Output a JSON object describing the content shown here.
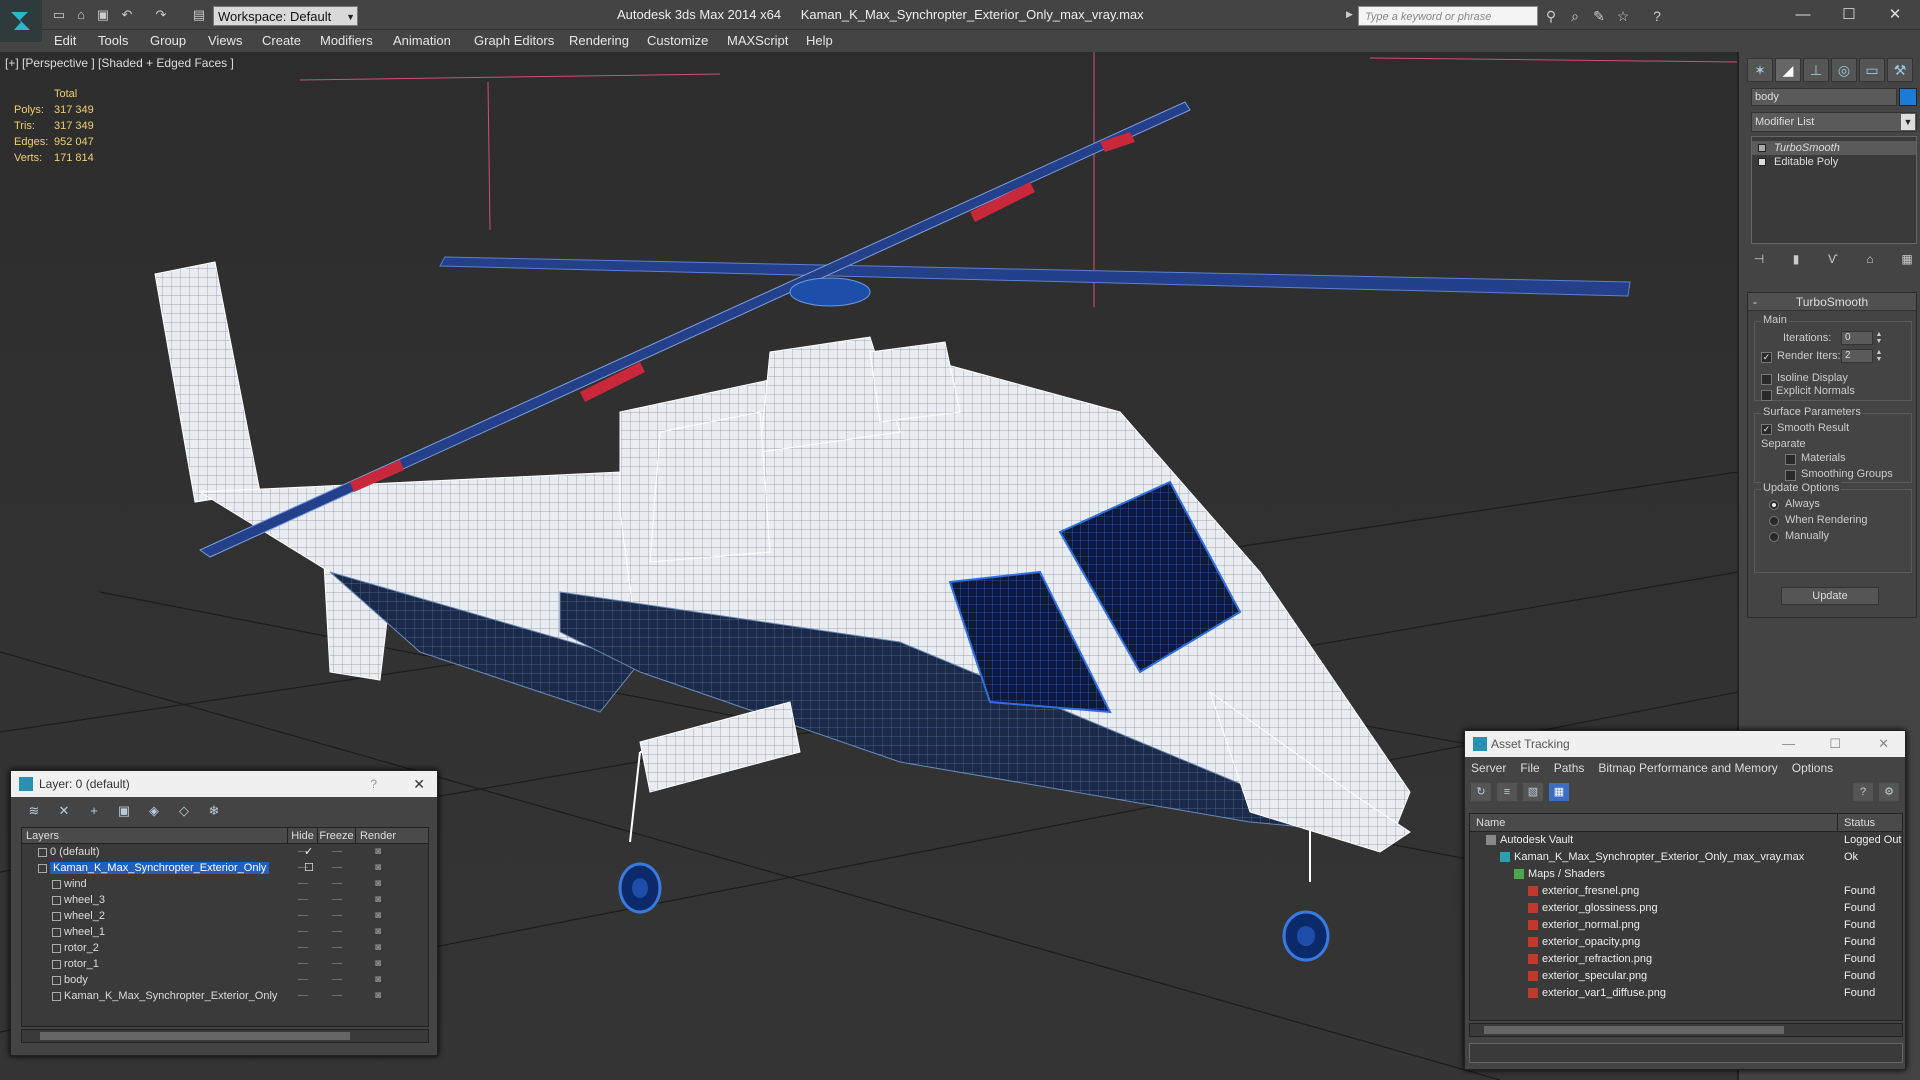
{
  "titlebar": {
    "workspace_label": "Workspace: Default",
    "app_name": "Autodesk 3ds Max  2014 x64",
    "file_name": "Kaman_K_Max_Synchropter_Exterior_Only_max_vray.max",
    "search_placeholder": "Type a keyword or phrase"
  },
  "menu": [
    "Edit",
    "Tools",
    "Group",
    "Views",
    "Create",
    "Modifiers",
    "Animation",
    "Graph Editors",
    "Rendering",
    "Customize",
    "MAXScript",
    "Help"
  ],
  "viewport": {
    "label": "[+] [Perspective ] [Shaded + Edged Faces ]",
    "stats_header": "Total",
    "stats": [
      {
        "key": "Polys:",
        "value": "317 349"
      },
      {
        "key": "Tris:",
        "value": "317 349"
      },
      {
        "key": "Edges:",
        "value": "952 047"
      },
      {
        "key": "Verts:",
        "value": "171 814"
      }
    ]
  },
  "command_panel": {
    "object_name": "body",
    "object_color": "#1b7bd8",
    "modifier_list": "Modifier List",
    "stack": [
      "TurboSmooth",
      "Editable Poly"
    ],
    "rollout_title": "TurboSmooth",
    "main_group": "Main",
    "iterations_label": "Iterations:",
    "iterations_value": "0",
    "render_iters_label": "Render Iters:",
    "render_iters_value": "2",
    "isoline_label": "Isoline Display",
    "explicit_normals_label": "Explicit Normals",
    "surface_group": "Surface Parameters",
    "smooth_result_label": "Smooth Result",
    "separate_label": "Separate",
    "materials_label": "Materials",
    "smoothing_groups_label": "Smoothing Groups",
    "update_group": "Update Options",
    "always_label": "Always",
    "when_rendering_label": "When Rendering",
    "manually_label": "Manually",
    "update_button": "Update"
  },
  "layer_dialog": {
    "title": "Layer: 0 (default)",
    "help": "?",
    "columns": {
      "layers": "Layers",
      "hide": "Hide",
      "freeze": "Freeze",
      "render": "Render"
    },
    "rows": [
      {
        "name": "0 (default)",
        "indent": 0,
        "selected": false
      },
      {
        "name": "Kaman_K_Max_Synchropter_Exterior_Only",
        "indent": 0,
        "selected": true
      },
      {
        "name": "wind",
        "indent": 1,
        "selected": false
      },
      {
        "name": "wheel_3",
        "indent": 1,
        "selected": false
      },
      {
        "name": "wheel_2",
        "indent": 1,
        "selected": false
      },
      {
        "name": "wheel_1",
        "indent": 1,
        "selected": false
      },
      {
        "name": "rotor_2",
        "indent": 1,
        "selected": false
      },
      {
        "name": "rotor_1",
        "indent": 1,
        "selected": false
      },
      {
        "name": "body",
        "indent": 1,
        "selected": false
      },
      {
        "name": "Kaman_K_Max_Synchropter_Exterior_Only",
        "indent": 1,
        "selected": false
      }
    ]
  },
  "asset_dialog": {
    "title": "Asset Tracking",
    "menu": [
      "Server",
      "File",
      "Paths",
      "Bitmap Performance and Memory",
      "Options"
    ],
    "columns": {
      "name": "Name",
      "status": "Status"
    },
    "rows": [
      {
        "name": "Autodesk Vault",
        "status": "Logged Out",
        "level": 0,
        "icon": "vault-icon"
      },
      {
        "name": "Kaman_K_Max_Synchropter_Exterior_Only_max_vray.max",
        "status": "Ok",
        "level": 1,
        "icon": "max-file-icon"
      },
      {
        "name": "Maps / Shaders",
        "status": "",
        "level": 2,
        "icon": "maps-folder-icon"
      },
      {
        "name": "exterior_fresnel.png",
        "status": "Found",
        "level": 3,
        "icon": "png-icon"
      },
      {
        "name": "exterior_glossiness.png",
        "status": "Found",
        "level": 3,
        "icon": "png-icon"
      },
      {
        "name": "exterior_normal.png",
        "status": "Found",
        "level": 3,
        "icon": "png-icon"
      },
      {
        "name": "exterior_opacity.png",
        "status": "Found",
        "level": 3,
        "icon": "png-icon"
      },
      {
        "name": "exterior_refraction.png",
        "status": "Found",
        "level": 3,
        "icon": "png-icon"
      },
      {
        "name": "exterior_specular.png",
        "status": "Found",
        "level": 3,
        "icon": "png-icon"
      },
      {
        "name": "exterior_var1_diffuse.png",
        "status": "Found",
        "level": 3,
        "icon": "png-icon"
      }
    ]
  }
}
